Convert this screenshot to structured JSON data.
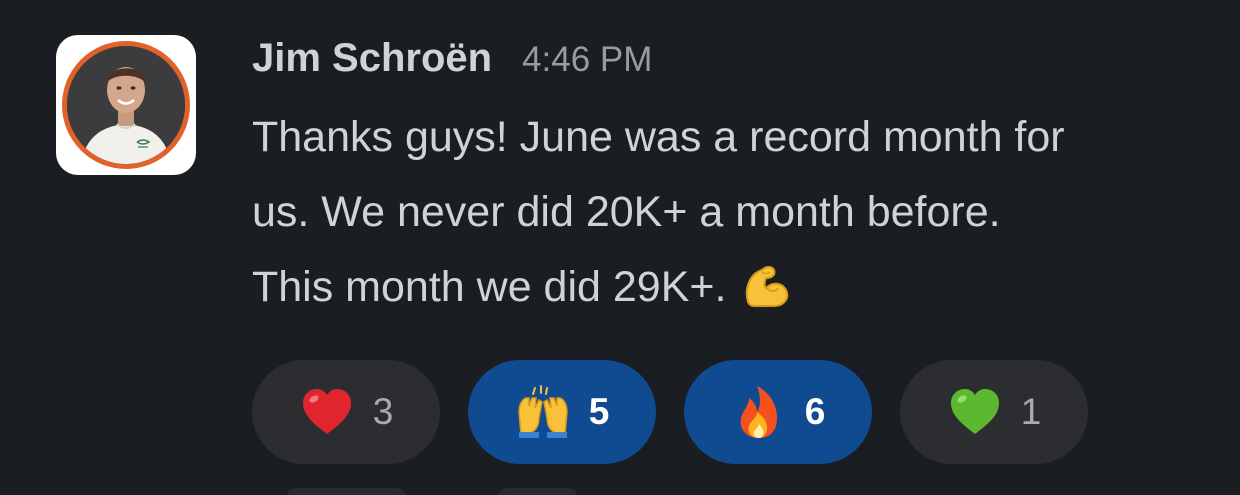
{
  "message": {
    "author": "Jim Schroën",
    "timestamp": "4:46 PM",
    "lines": [
      "Thanks guys! June was a record month for",
      "us. We never did 20K+ a month before.",
      "This month we did 29K+."
    ],
    "inline_emoji": "flexed-biceps"
  },
  "reactions": [
    {
      "emoji": "red-heart",
      "count": "3",
      "selected": false
    },
    {
      "emoji": "raising-hands",
      "count": "5",
      "selected": true
    },
    {
      "emoji": "fire",
      "count": "6",
      "selected": true
    },
    {
      "emoji": "green-heart",
      "count": "1",
      "selected": false
    }
  ],
  "colors": {
    "background": "#1a1d21",
    "text": "#d1d2d3",
    "timestamp": "#9a9b9d",
    "reaction_default": "#2c2d30",
    "reaction_selected": "#104a91",
    "avatar_ring": "#e0622a"
  }
}
